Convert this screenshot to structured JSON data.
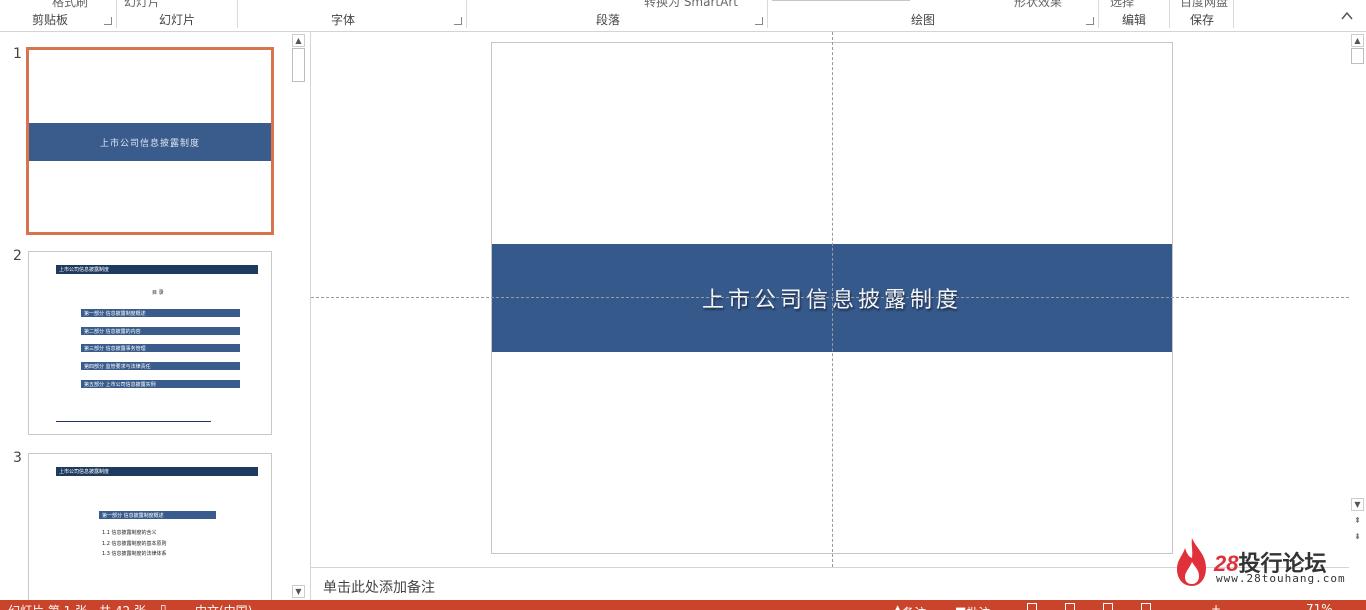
{
  "ribbon": {
    "partial_top": {
      "paste_fragment": "格式刷",
      "slides_fragment": "幻灯片",
      "smartart_fragment": "转换为 SmartArt",
      "effects_fragment": "形状效果",
      "select_fragment": "选择",
      "baidu_fragment": "百度网盘"
    },
    "groups": [
      "剪贴板",
      "幻灯片",
      "字体",
      "段落",
      "绘图",
      "编辑",
      "保存"
    ]
  },
  "thumbnails": [
    {
      "number": "1",
      "title": "上市公司信息披露制度",
      "selected": true
    },
    {
      "number": "2",
      "header": "上市公司信息披露制度",
      "toc_title": "目 录",
      "items": [
        "第一部分 信息披露制度概述",
        "第二部分 信息披露的内容",
        "第三部分 信息披露事务管理",
        "第四部分 监管要求与法律责任",
        "第五部分 上市公司信息披露实例"
      ]
    },
    {
      "number": "3",
      "header": "上市公司信息披露制度",
      "section": "第一部分 信息披露制度概述",
      "items": [
        "1.1 信息披露制度的含义",
        "1.2 信息披露制度的基本原则",
        "1.3 信息披露制度的法律体系"
      ]
    }
  ],
  "slide": {
    "title": "上市公司信息披露制度"
  },
  "notes": {
    "placeholder": "单击此处添加备注"
  },
  "watermark": {
    "brand_num": "28",
    "brand_text": "投行论坛",
    "url": "www.28touhang.com"
  },
  "status": {
    "slide_info": "幻灯片 第 1 张，共 42 张",
    "language": "中文(中国)",
    "notes_label": "备注",
    "comments_label": "批注",
    "zoom": "71%"
  },
  "colors": {
    "accent": "#c9442b",
    "band": "#36598c",
    "selection": "#d5744f"
  }
}
